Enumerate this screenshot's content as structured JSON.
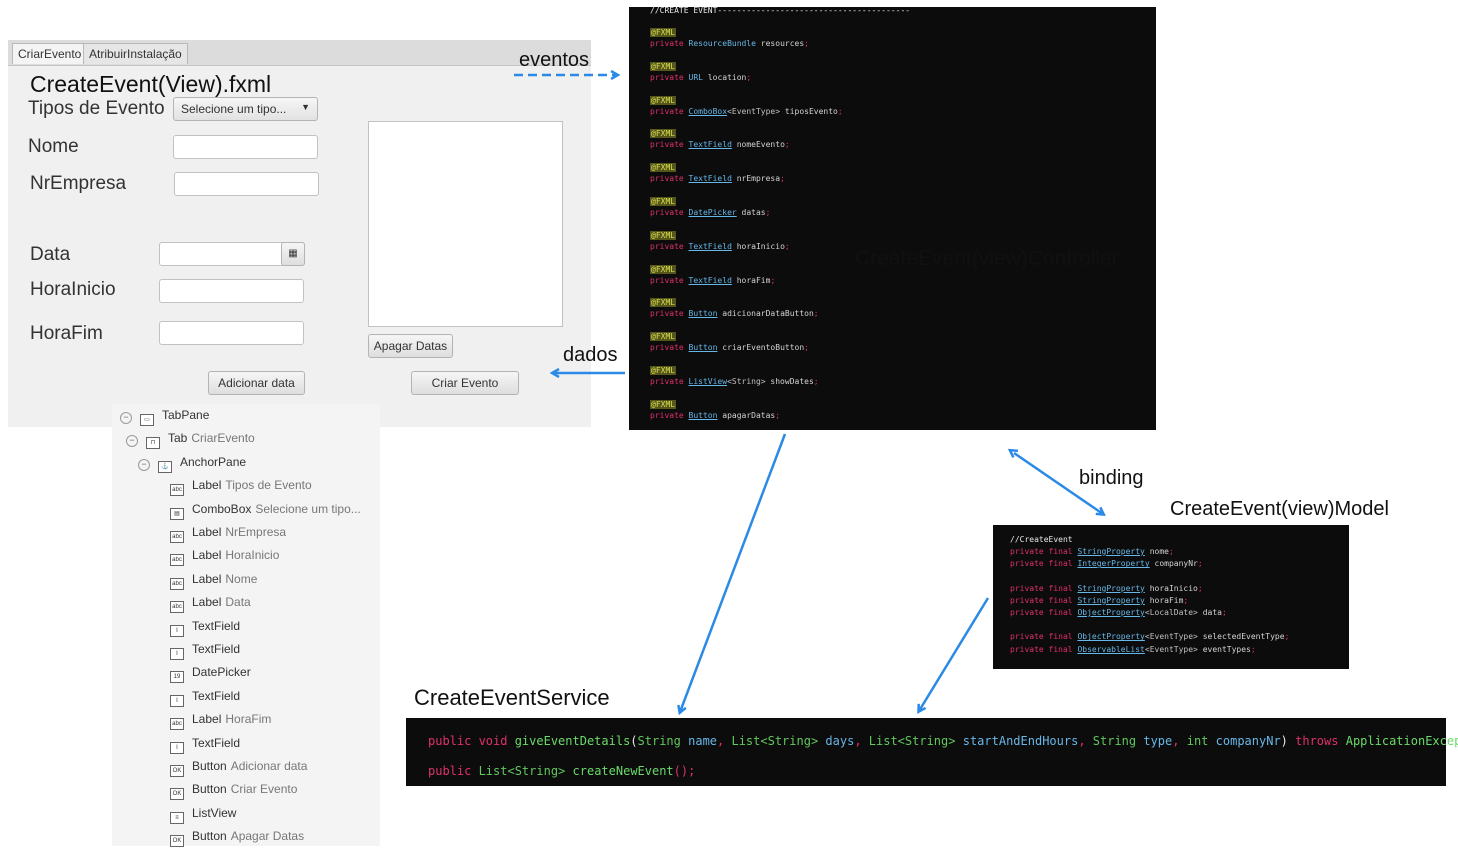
{
  "form": {
    "tabs": [
      "CriarEvento",
      "AtribuirInstalação"
    ],
    "title": "CreateEvent(View).fxml",
    "labels": {
      "tipos": "Tipos de Evento",
      "nome": "Nome",
      "nr_empresa": "NrEmpresa",
      "data": "Data",
      "hora_inicio": "HoraInicio",
      "hora_fim": "HoraFim"
    },
    "combo_placeholder": "Selecione um tipo...",
    "buttons": {
      "apagar": "Apagar Datas",
      "adicionar": "Adicionar data",
      "criar": "Criar Evento"
    }
  },
  "tree": [
    {
      "indent": 0,
      "toggle": true,
      "icon": "tabpane-icon",
      "kind": "TabPane",
      "text": ""
    },
    {
      "indent": 1,
      "toggle": true,
      "icon": "tab-icon",
      "kind": "Tab",
      "text": "CriarEvento"
    },
    {
      "indent": 2,
      "toggle": true,
      "icon": "anchorpane-icon",
      "kind": "AnchorPane",
      "text": ""
    },
    {
      "indent": 3,
      "toggle": false,
      "icon": "label-icon",
      "kind": "Label",
      "text": "Tipos de Evento"
    },
    {
      "indent": 3,
      "toggle": false,
      "icon": "combobox-icon",
      "kind": "ComboBox",
      "text": "Selecione um tipo..."
    },
    {
      "indent": 3,
      "toggle": false,
      "icon": "label-icon",
      "kind": "Label",
      "text": "NrEmpresa"
    },
    {
      "indent": 3,
      "toggle": false,
      "icon": "label-icon",
      "kind": "Label",
      "text": "HoraInicio"
    },
    {
      "indent": 3,
      "toggle": false,
      "icon": "label-icon",
      "kind": "Label",
      "text": "Nome"
    },
    {
      "indent": 3,
      "toggle": false,
      "icon": "label-icon",
      "kind": "Label",
      "text": "Data"
    },
    {
      "indent": 3,
      "toggle": false,
      "icon": "textfield-icon",
      "kind": "TextField",
      "text": ""
    },
    {
      "indent": 3,
      "toggle": false,
      "icon": "textfield-icon",
      "kind": "TextField",
      "text": ""
    },
    {
      "indent": 3,
      "toggle": false,
      "icon": "datepicker-icon",
      "kind": "DatePicker",
      "text": ""
    },
    {
      "indent": 3,
      "toggle": false,
      "icon": "textfield-icon",
      "kind": "TextField",
      "text": ""
    },
    {
      "indent": 3,
      "toggle": false,
      "icon": "label-icon",
      "kind": "Label",
      "text": "HoraFim"
    },
    {
      "indent": 3,
      "toggle": false,
      "icon": "textfield-icon",
      "kind": "TextField",
      "text": ""
    },
    {
      "indent": 3,
      "toggle": false,
      "icon": "button-icon",
      "kind": "Button",
      "text": "Adicionar data"
    },
    {
      "indent": 3,
      "toggle": false,
      "icon": "button-icon",
      "kind": "Button",
      "text": "Criar Evento"
    },
    {
      "indent": 3,
      "toggle": false,
      "icon": "listview-icon",
      "kind": "ListView",
      "text": ""
    },
    {
      "indent": 3,
      "toggle": false,
      "icon": "button-icon",
      "kind": "Button",
      "text": "Apagar Datas"
    }
  ],
  "controller": {
    "comment": "//CREATE EVENT----------------------------------------",
    "annotation": "@FXML",
    "fields": [
      {
        "type": "ResourceBundle",
        "generic": "",
        "name": "resources",
        "underline": false
      },
      {
        "type": "URL",
        "generic": "",
        "name": "location",
        "underline": false
      },
      {
        "type": "ComboBox",
        "generic": "<EventType>",
        "name": "tiposEvento",
        "underline": true
      },
      {
        "type": "TextField",
        "generic": "",
        "name": "nomeEvento",
        "underline": true
      },
      {
        "type": "TextField",
        "generic": "",
        "name": "nrEmpresa",
        "underline": true
      },
      {
        "type": "DatePicker",
        "generic": "",
        "name": "datas",
        "underline": true
      },
      {
        "type": "TextField",
        "generic": "",
        "name": "horaInicio",
        "underline": true
      },
      {
        "type": "TextField",
        "generic": "",
        "name": "horaFim",
        "underline": true
      },
      {
        "type": "Button",
        "generic": "",
        "name": "adicionarDataButton",
        "underline": true
      },
      {
        "type": "Button",
        "generic": "",
        "name": "criarEventoButton",
        "underline": true
      },
      {
        "type": "ListView",
        "generic": "<String>",
        "name": "showDates",
        "underline": true
      },
      {
        "type": "Button",
        "generic": "",
        "name": "apagarDatas",
        "underline": true
      }
    ]
  },
  "model": {
    "comment": "//CreateEvent",
    "lines": [
      {
        "type": "StringProperty",
        "generic": "",
        "name": "nome"
      },
      {
        "type": "IntegerProperty",
        "generic": "",
        "name": "companyNr"
      },
      null,
      {
        "type": "StringProperty",
        "generic": "",
        "name": "horaInicio"
      },
      {
        "type": "StringProperty",
        "generic": "",
        "name": "horaFim"
      },
      {
        "type": "ObjectProperty",
        "generic": "<LocalDate>",
        "name": "data"
      },
      null,
      {
        "type": "ObjectProperty",
        "generic": "<EventType>",
        "name": "selectedEventType"
      },
      {
        "type": "ObservableList",
        "generic": "<EventType>",
        "name": "eventTypes"
      }
    ]
  },
  "service": {
    "line1": {
      "prefix": "public void ",
      "method": "giveEventDetails",
      "params": [
        [
          "String",
          "name"
        ],
        [
          "List<String>",
          "days"
        ],
        [
          "List<String>",
          "startAndEndHours"
        ],
        [
          "String",
          "type"
        ],
        [
          "int",
          "companyNr"
        ]
      ],
      "throws": "throws",
      "exception": "ApplicationException;"
    },
    "line2": {
      "prefix": "public ",
      "type": "List<String>",
      "method": "createNewEvent",
      "suffix": "();"
    }
  },
  "labels": {
    "eventos": "eventos",
    "dados": "dados",
    "controller": "CreateEvent(view)Controller",
    "binding": "binding",
    "model": "CreateEvent(view)Model",
    "service": "CreateEventService"
  },
  "colors": {
    "arrow": "#2b8ae6",
    "code_bg": "#0c0c0c",
    "keyword": "#e0306c",
    "type": "#67b7e8",
    "annotation": "#d8dc4e",
    "method": "#6adb69"
  }
}
